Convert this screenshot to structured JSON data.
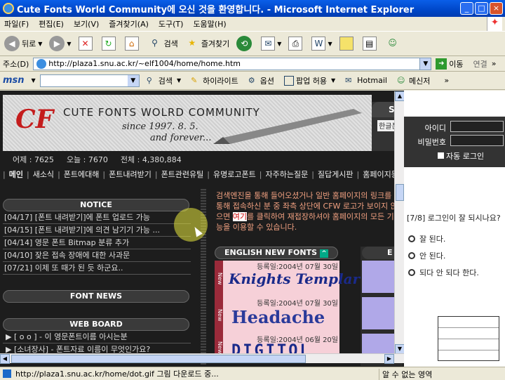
{
  "window": {
    "title": "Cute Fonts World Community에 오신 것을 환영합니다. - Microsoft Internet Explorer",
    "minimize": "_",
    "maximize": "□",
    "close": "×"
  },
  "menu": [
    "파일(F)",
    "편집(E)",
    "보기(V)",
    "즐겨찾기(A)",
    "도구(T)",
    "도움말(H)"
  ],
  "toolbar": {
    "back_label": "뒤로",
    "search_label": "검색",
    "favorites_label": "즐겨찾기"
  },
  "address": {
    "label": "주소(D)",
    "url": "http://plaza1.snu.ac.kr/~elf1004/home/home.htm",
    "go_label": "이동",
    "links_label": "연결"
  },
  "msnbar": {
    "logo": "msn",
    "search_label": "검색",
    "highlight_label": "하이라이트",
    "options_label": "옵션",
    "popup_label": "팝업 허용",
    "hotmail_label": "Hotmail",
    "messenger_label": "메신저"
  },
  "site": {
    "logo": "CF",
    "title": "CUTE FONTS WOLRD COMMUNITY",
    "since": "since 1997. 8. 5.",
    "forever": "and forever...",
    "search_tab": "SEA",
    "search_value": "한글폰",
    "stats": [
      "어제 : 7625",
      "오늘 : 7670",
      "전체 : 4,380,884"
    ],
    "nav": [
      "메인",
      "새소식",
      "폰트에대해",
      "폰트내려받기",
      "폰트관련유틸",
      "유명로고폰트",
      "자주하는질문",
      "질답게시판",
      "홈페이지등록"
    ],
    "notice_head": "NOTICE",
    "notices": [
      "[04/17]  [폰트 내려받기]에 폰트 업로드 가능",
      "[04/15]  [폰트 내려받기]에 의견 남기기 가능 ...",
      "[04/14]  영문 폰트 Bitmap 분류 추가",
      "[04/10]  잦은 접속 장애에 대한 사과문",
      "[07/21]  이제 또 때가 된 듯 하군요.."
    ],
    "fontnews_head": "FONT NEWS",
    "webboard_head": "WEB BOARD",
    "webboard": [
      "▶ [ o o ] - 이 영문폰트이름 아시는분",
      "▶ [소녀장사] - 폰트자료 이름이 무엇인가요?"
    ],
    "message_1": "검색엔진을 통해 들어오셨거나 일반 홈페이지의 링크를 통해 접속하신 분 중 좌측 상단에 CFW 로고가 보이지 않으면 ",
    "message_link": "여기",
    "message_2": "를 클릭하여 재접장하셔야 홈페이지의 모든 기능을 이용할 수 있습니다.",
    "english_head": "ENGLISH NEW FONTS",
    "english_up": "^",
    "right_head": "E",
    "new_badge": "New",
    "fonts": [
      {
        "date": "등록일:2004년 07월 30일",
        "sample": "Knights Templar"
      },
      {
        "date": "등록일:2004년 07월 30일",
        "sample": "Headache"
      },
      {
        "date": "등록일:2004년 06월 20일",
        "sample": "DIGITOL"
      }
    ]
  },
  "overlay": {
    "id_label": "아이디",
    "pw_label": "비밀번호",
    "autologin_label": "자동 로그인",
    "poll_title": "[7/8] 로그인이 잘 되시나요?",
    "poll_options": [
      "잘 된다.",
      "안 된다.",
      "되다 안 되다 한다."
    ]
  },
  "status": {
    "text": "http://plaza1.snu.ac.kr/home/dot.gif 그림 다운로드 중...",
    "zone": "알 수 없는 영역"
  }
}
